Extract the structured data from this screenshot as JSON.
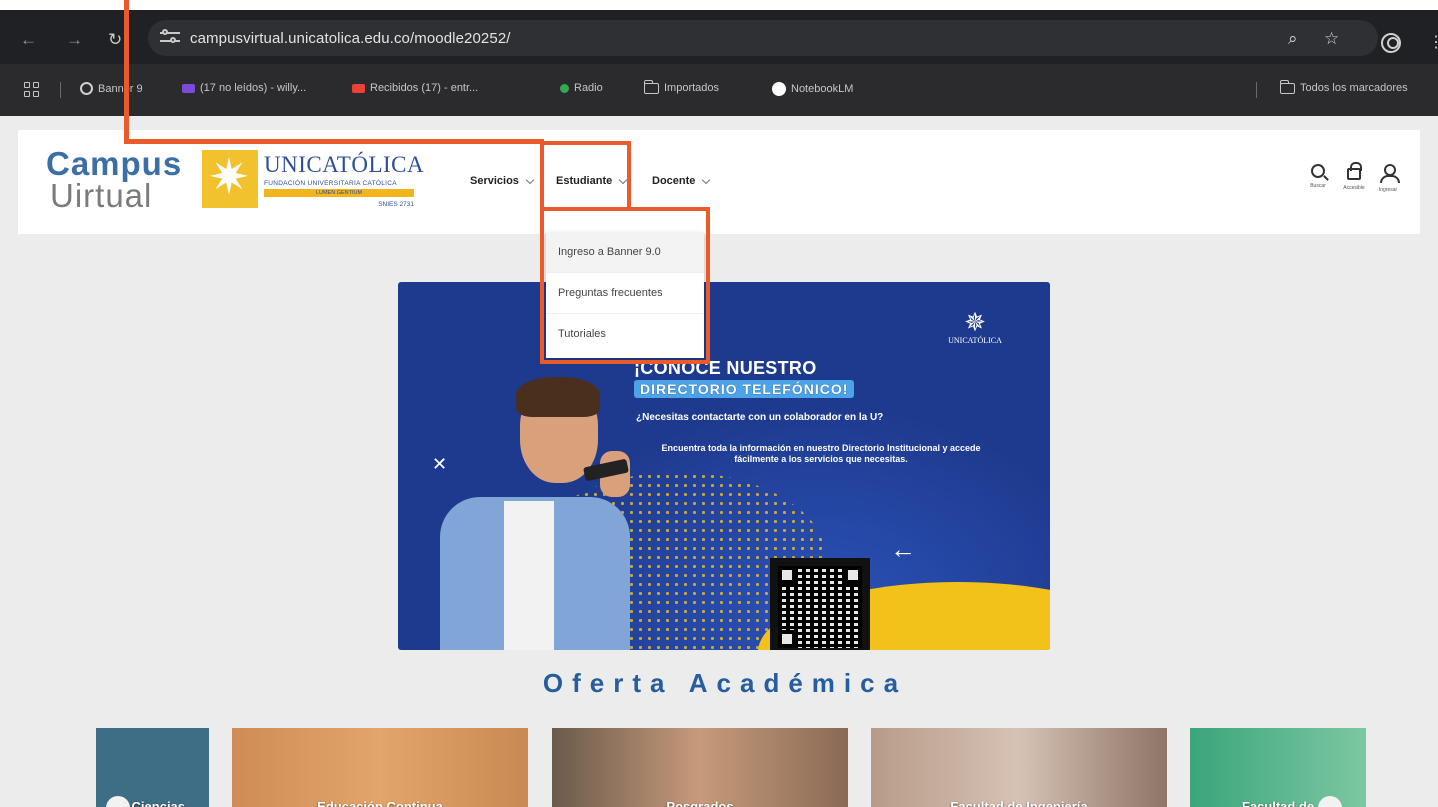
{
  "browser": {
    "url": "campusvirtual.unicatolica.edu.co/moodle20252/",
    "bookmarks": [
      {
        "label": "Banner 9",
        "color": "#cfcfcf"
      },
      {
        "label": "(17 no leídos) - willy...",
        "color": "#7b4ad9"
      },
      {
        "label": "Recibidos (17) - entr...",
        "color": "#ea4335"
      },
      {
        "label": "Radio",
        "color": "#34a853"
      },
      {
        "label": "Importados",
        "color": ""
      },
      {
        "label": "NotebookLM",
        "color": "#ffffff"
      }
    ],
    "all_bookmarks": "Todos los marcadores"
  },
  "header": {
    "logo_campus_line1": "Campus",
    "logo_campus_line2": "Uirtual",
    "logo_uni_name": "UNICATÓLICA",
    "logo_uni_sub": "FUNDACIÓN UNIVERSITARIA CATÓLICA",
    "logo_uni_motto": "LUMEN GENTIUM",
    "logo_uni_code": "SNIES 2731",
    "menu": [
      {
        "label": "Servicios"
      },
      {
        "label": "Estudiante"
      },
      {
        "label": "Docente"
      }
    ],
    "utils": [
      {
        "label": "Buscar",
        "icon": "search-icon"
      },
      {
        "label": "Accesible",
        "icon": "lock-icon"
      },
      {
        "label": "Ingresar",
        "icon": "user-icon"
      }
    ]
  },
  "dropdown": {
    "items": [
      {
        "label": "Ingreso a Banner 9.0"
      },
      {
        "label": "Preguntas frecuentes"
      },
      {
        "label": "Tutoriales"
      }
    ]
  },
  "banner": {
    "logo_name": "UNICATÓLICA",
    "title": "¡CONOCE NUESTRO",
    "highlight": "DIRECTORIO TELEFÓNICO!",
    "question": "¿Necesitas contactarte con un colaborador en la U?",
    "body": "Encuentra toda la información en nuestro Directorio Institucional y accede fácilmente a los servicios que necesitas."
  },
  "oferta": {
    "title": "Oferta Académica",
    "cards": [
      {
        "label": "n Ciencias"
      },
      {
        "label": "Educación Continua"
      },
      {
        "label": "Posgrados"
      },
      {
        "label": "Facultad de Ingeniería"
      },
      {
        "label": "Facultad de"
      }
    ]
  },
  "colors": {
    "accent_orange": "#ea5a2a",
    "brand_blue": "#255d9e",
    "banner_blue": "#1e3a8e"
  }
}
